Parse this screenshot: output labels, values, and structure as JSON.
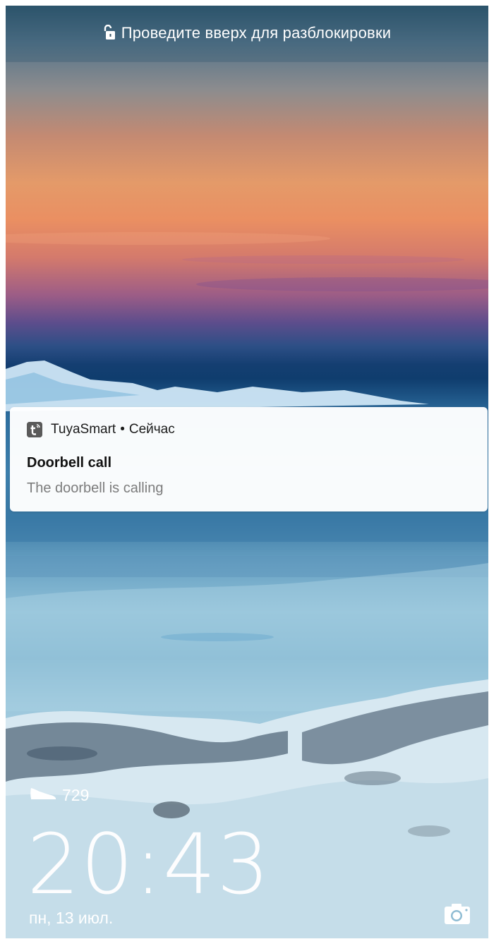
{
  "lockscreen": {
    "unlock_hint": "Проведите вверх для разблокировки",
    "lock_icon": "unlock-padlock-icon",
    "steps_icon": "shoe-icon",
    "steps_count": "729",
    "time": "20:43",
    "date": "пн, 13 июл.",
    "camera_icon": "camera-icon"
  },
  "notification": {
    "app_icon": "tuyasmart-app-icon",
    "app_name": "TuyaSmart",
    "separator": "•",
    "time": "Сейчас",
    "title": "Doorbell call",
    "body": "The doorbell is calling"
  },
  "colors": {
    "notification_bg": "#ffffff",
    "notification_title": "#111111",
    "notification_body": "#7c7c7c",
    "lockscreen_text": "#ffffff"
  }
}
